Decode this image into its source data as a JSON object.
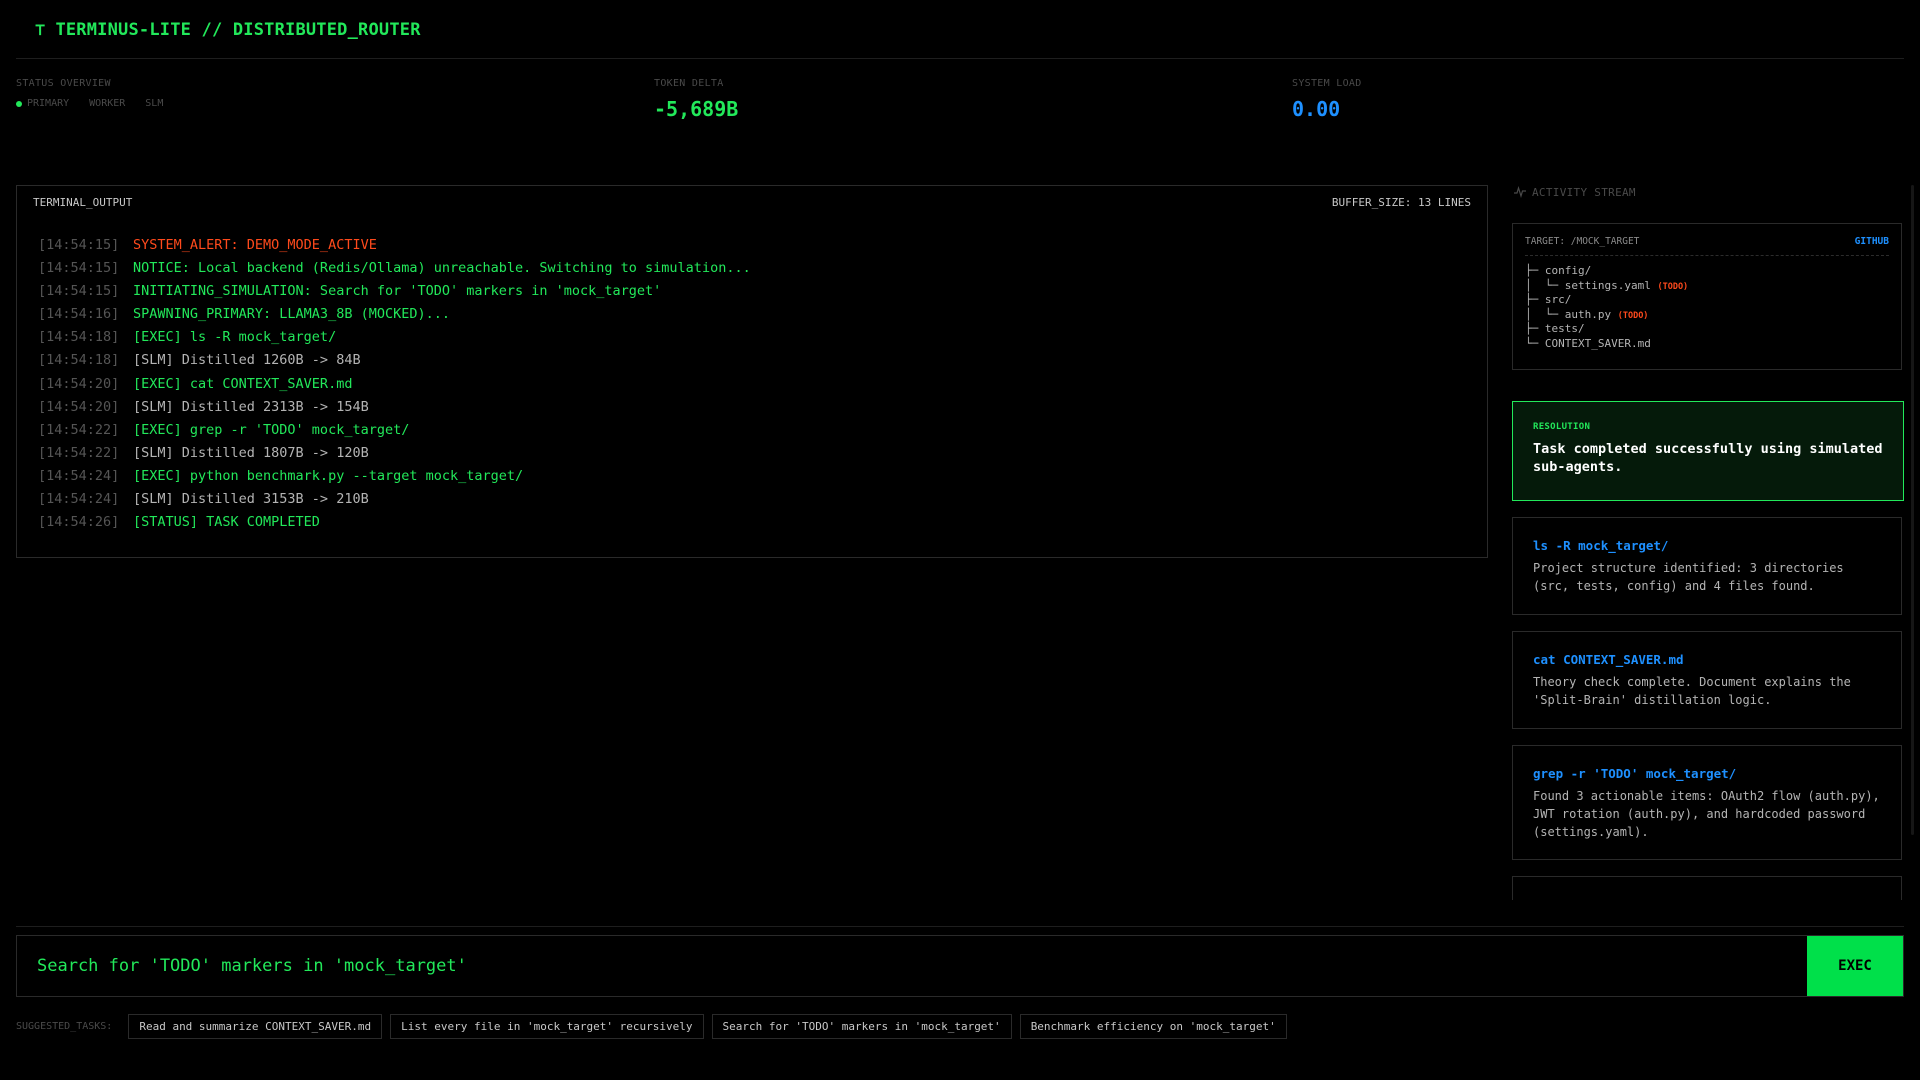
{
  "header": {
    "icon": "terminal-t-icon",
    "title": "TERMINUS-LITE // DISTRIBUTED_ROUTER"
  },
  "stats": {
    "status": {
      "label": "STATUS OVERVIEW",
      "modes": [
        "PRIMARY",
        "WORKER",
        "SLM"
      ],
      "active_mode": "PRIMARY"
    },
    "tokens": {
      "label": "TOKEN DELTA",
      "value": "-5,689B"
    },
    "load": {
      "label": "SYSTEM LOAD",
      "value": "0.00"
    }
  },
  "terminal": {
    "title": "TERMINAL_OUTPUT",
    "buffer": "BUFFER_SIZE: 13 LINES",
    "lines": [
      {
        "ts": "[14:54:15]",
        "msg": "SYSTEM_ALERT: DEMO_MODE_ACTIVE",
        "kind": "alert"
      },
      {
        "ts": "[14:54:15]",
        "msg": "NOTICE: Local backend (Redis/Ollama) unreachable. Switching to simulation...",
        "kind": "green"
      },
      {
        "ts": "[14:54:15]",
        "msg": "INITIATING_SIMULATION: Search for 'TODO' markers in 'mock_target'",
        "kind": "green"
      },
      {
        "ts": "[14:54:16]",
        "msg": "SPAWNING_PRIMARY: LLAMA3_8B (MOCKED)...",
        "kind": "green"
      },
      {
        "ts": "[14:54:18]",
        "msg": "[EXEC] ls -R mock_target/",
        "kind": "green"
      },
      {
        "ts": "[14:54:18]",
        "msg": "[SLM] Distilled 1260B -> 84B",
        "kind": "gray"
      },
      {
        "ts": "[14:54:20]",
        "msg": "[EXEC] cat CONTEXT_SAVER.md",
        "kind": "green"
      },
      {
        "ts": "[14:54:20]",
        "msg": "[SLM] Distilled 2313B -> 154B",
        "kind": "gray"
      },
      {
        "ts": "[14:54:22]",
        "msg": "[EXEC] grep -r 'TODO' mock_target/",
        "kind": "green"
      },
      {
        "ts": "[14:54:22]",
        "msg": "[SLM] Distilled 1807B -> 120B",
        "kind": "gray"
      },
      {
        "ts": "[14:54:24]",
        "msg": "[EXEC] python benchmark.py --target mock_target/",
        "kind": "green"
      },
      {
        "ts": "[14:54:24]",
        "msg": "[SLM] Distilled 3153B -> 210B",
        "kind": "gray"
      },
      {
        "ts": "[14:54:26]",
        "msg": "[STATUS] TASK COMPLETED",
        "kind": "green"
      }
    ]
  },
  "activity": {
    "title": "ACTIVITY STREAM",
    "tree": {
      "target": "TARGET: /MOCK_TARGET",
      "link": "GITHUB",
      "lines": [
        {
          "text": "├─ config/",
          "todo": ""
        },
        {
          "text": "│  └─ settings.yaml",
          "todo": "(TODO)"
        },
        {
          "text": "├─ src/",
          "todo": ""
        },
        {
          "text": "│  └─ auth.py",
          "todo": "(TODO)"
        },
        {
          "text": "├─ tests/",
          "todo": ""
        },
        {
          "text": "└─ CONTEXT_SAVER.md",
          "todo": ""
        }
      ]
    },
    "resolution": {
      "label": "RESOLUTION",
      "text": "Task completed successfully using simulated sub-agents."
    },
    "logs": [
      {
        "cmd": "ls -R mock_target/",
        "desc": "Project structure identified: 3 directories (src, tests, config) and 4 files found."
      },
      {
        "cmd": "cat CONTEXT_SAVER.md",
        "desc": "Theory check complete. Document explains the 'Split-Brain' distillation logic."
      },
      {
        "cmd": "grep -r 'TODO' mock_target/",
        "desc": "Found 3 actionable items: OAuth2 flow (auth.py), JWT rotation (auth.py), and hardcoded password (settings.yaml)."
      }
    ]
  },
  "input": {
    "value": "Search for 'TODO' markers in 'mock_target'",
    "exec_label": "EXEC"
  },
  "suggested": {
    "label": "SUGGESTED_TASKS:",
    "tasks": [
      "Read and summarize CONTEXT_SAVER.md",
      "List every file in 'mock_target' recursively",
      "Search for 'TODO' markers in 'mock_target'",
      "Benchmark efficiency on 'mock_target'"
    ]
  },
  "colors": {
    "accent_green": "#22e85a",
    "accent_blue": "#1e90ff",
    "alert_red": "#ff4a1c",
    "exec_green": "#00e04a"
  }
}
